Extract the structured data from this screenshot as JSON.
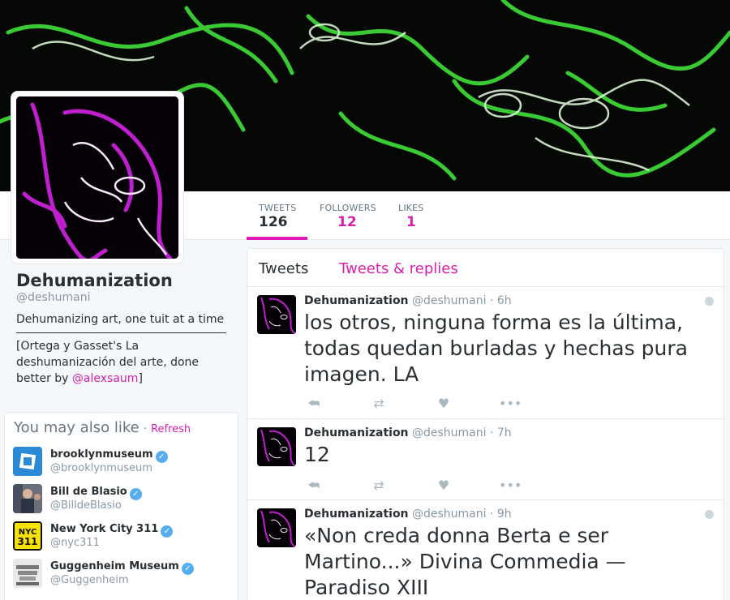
{
  "colors": {
    "accent": "#d71fae",
    "tab_underline": "#e31ab8",
    "verified": "#55acee",
    "muted": "#8899a6"
  },
  "stats": [
    {
      "label": "TWEETS",
      "value": "126"
    },
    {
      "label": "FOLLOWERS",
      "value": "12"
    },
    {
      "label": "LIKES",
      "value": "1"
    }
  ],
  "profile": {
    "name": "Dehumanization",
    "handle": "@deshumani",
    "bio": "Dehumanizing art, one tuit at a time",
    "bio2_prefix": "[Ortega y Gasset's La deshumanización del arte, done better by ",
    "bio2_link": "@alexsaum",
    "bio2_suffix": "]"
  },
  "who_to_follow": {
    "title": "You may also like",
    "dot": "·",
    "refresh": "Refresh",
    "items": [
      {
        "name": "brooklynmuseum",
        "handle": "@brooklynmuseum",
        "icon": "brooklyn-museum-logo-icon"
      },
      {
        "name": "Bill de Blasio",
        "handle": "@BilldeBlasio",
        "icon": "photo-avatar"
      },
      {
        "name": "New York City 311",
        "handle": "@nyc311",
        "icon": "nyc311-logo-icon",
        "logo_text": "NYC\n311"
      },
      {
        "name": "Guggenheim Museum",
        "handle": "@Guggenheim",
        "icon": "guggenheim-logo-icon"
      }
    ]
  },
  "tabs": {
    "tweets": "Tweets",
    "replies": "Tweets & replies"
  },
  "tweets": [
    {
      "name": "Dehumanization",
      "handle": "@deshumani",
      "sep": "·",
      "time": "6h",
      "text": "los otros, ninguna forma es la última, todas quedan burladas y hechas pura imagen. LA"
    },
    {
      "name": "Dehumanization",
      "handle": "@deshumani",
      "sep": "·",
      "time": "7h",
      "text": "12"
    },
    {
      "name": "Dehumanization",
      "handle": "@deshumani",
      "sep": "·",
      "time": "9h",
      "text": "«Non creda donna Berta e ser Martino...» Divina Commedia — Paradiso XIII"
    }
  ],
  "action_icons": [
    "reply-icon",
    "retweet-icon",
    "like-icon",
    "more-icon"
  ]
}
